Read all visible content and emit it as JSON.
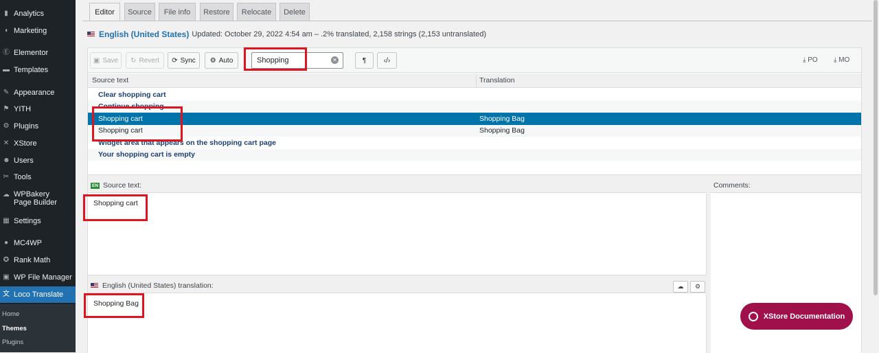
{
  "sidebar": {
    "items": [
      {
        "label": "Analytics",
        "icon": "bar-chart-icon",
        "glyph": "▮"
      },
      {
        "label": "Marketing",
        "icon": "megaphone-icon",
        "glyph": "◖"
      },
      {
        "label": "Elementor",
        "icon": "elementor-icon",
        "glyph": "Ⓔ"
      },
      {
        "label": "Templates",
        "icon": "folder-icon",
        "glyph": "▬"
      },
      {
        "label": "Appearance",
        "icon": "paintbrush-icon",
        "glyph": "✎"
      },
      {
        "label": "YITH",
        "icon": "yith-icon",
        "glyph": "⚑"
      },
      {
        "label": "Plugins",
        "icon": "plug-icon",
        "glyph": "⚙"
      },
      {
        "label": "XStore",
        "icon": "xstore-icon",
        "glyph": "✕"
      },
      {
        "label": "Users",
        "icon": "users-icon",
        "glyph": "☻"
      },
      {
        "label": "Tools",
        "icon": "wrench-icon",
        "glyph": "✂"
      },
      {
        "label": "WPBakery Page Builder",
        "icon": "cloud-icon",
        "glyph": "☁"
      },
      {
        "label": "Settings",
        "icon": "settings-icon",
        "glyph": "▦"
      },
      {
        "label": "MC4WP",
        "icon": "mc4wp-icon",
        "glyph": "●"
      },
      {
        "label": "Rank Math",
        "icon": "rank-math-icon",
        "glyph": "✪"
      },
      {
        "label": "WP File Manager",
        "icon": "file-manager-icon",
        "glyph": "▣"
      },
      {
        "label": "Loco Translate",
        "icon": "translate-icon",
        "glyph": "文"
      }
    ],
    "submenu": [
      "Home",
      "Themes",
      "Plugins"
    ]
  },
  "tabs": [
    "Editor",
    "Source",
    "File info",
    "Restore",
    "Relocate",
    "Delete"
  ],
  "lang": {
    "name": "English (United States)",
    "meta": "Updated: October 29, 2022 4:54 am – .2% translated, 2,158 strings (2,153 untranslated)"
  },
  "toolbar": {
    "save": "Save",
    "revert": "Revert",
    "sync": "Sync",
    "auto": "Auto",
    "search_value": "Shopping",
    "po": "PO",
    "mo": "MO"
  },
  "table": {
    "col_source": "Source text",
    "col_translation": "Translation",
    "rows": [
      {
        "source": "Clear shopping cart",
        "translation": ""
      },
      {
        "source": "Continue shopping",
        "translation": ""
      },
      {
        "source": "Shopping cart",
        "translation": "Shopping Bag"
      },
      {
        "source": "Shopping cart",
        "translation": "Shopping Bag"
      },
      {
        "source": "Widget area that appears on the shopping cart page",
        "translation": ""
      },
      {
        "source": "Your shopping cart is empty",
        "translation": ""
      }
    ]
  },
  "source_panel": {
    "badge": "EN",
    "label": "Source text:",
    "value": "Shopping cart"
  },
  "comments_panel": {
    "label": "Comments:"
  },
  "translation_panel": {
    "label": "English (United States) translation:",
    "value": "Shopping Bag"
  },
  "doc_button": "XStore Documentation",
  "colors": {
    "accent": "#2271b1",
    "selected_row": "#0073aa",
    "highlight": "#e0141e",
    "doc_button": "#a0114c"
  }
}
